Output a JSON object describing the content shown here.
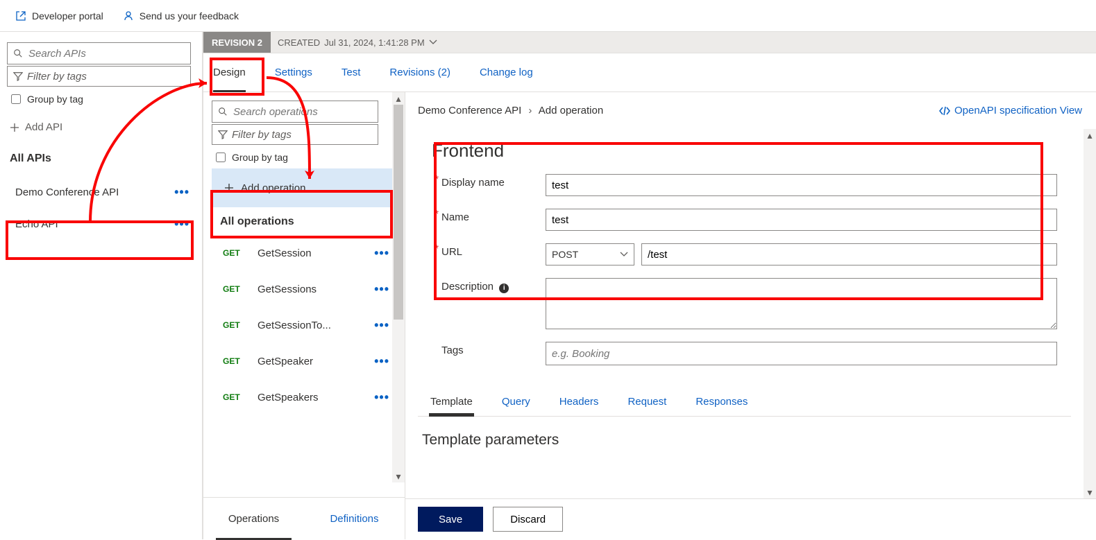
{
  "topbar": {
    "devPortal": "Developer portal",
    "feedback": "Send us your feedback"
  },
  "leftPanel": {
    "searchPlaceholder": "Search APIs",
    "filterPlaceholder": "Filter by tags",
    "groupByTag": "Group by tag",
    "addApi": "Add API",
    "allApisHeader": "All APIs",
    "apis": [
      {
        "name": "Demo Conference API"
      },
      {
        "name": "Echo API"
      }
    ]
  },
  "revisionBar": {
    "badge": "REVISION 2",
    "createdPrefix": "CREATED",
    "createdDate": "Jul 31, 2024, 1:41:28 PM"
  },
  "mainTabs": {
    "design": "Design",
    "settings": "Settings",
    "test": "Test",
    "revisions": "Revisions (2)",
    "changeLog": "Change log"
  },
  "opsPanel": {
    "searchPlaceholder": "Search operations",
    "filterPlaceholder": "Filter by tags",
    "groupByTag": "Group by tag",
    "addOperation": "Add operation",
    "allOpsHeader": "All operations",
    "operations": [
      {
        "method": "GET",
        "name": "GetSession"
      },
      {
        "method": "GET",
        "name": "GetSessions"
      },
      {
        "method": "GET",
        "name": "GetSessionTo..."
      },
      {
        "method": "GET",
        "name": "GetSpeaker"
      },
      {
        "method": "GET",
        "name": "GetSpeakers"
      }
    ],
    "tabOperations": "Operations",
    "tabDefinitions": "Definitions"
  },
  "breadcrumb": {
    "api": "Demo Conference API",
    "op": "Add operation"
  },
  "openApiLink": "OpenAPI specification View",
  "frontend": {
    "title": "Frontend",
    "labels": {
      "displayName": "Display name",
      "name": "Name",
      "url": "URL",
      "description": "Description",
      "tags": "Tags"
    },
    "values": {
      "displayName": "test",
      "name": "test",
      "method": "POST",
      "urlPath": "/test",
      "description": "",
      "tagsPlaceholder": "e.g. Booking"
    }
  },
  "subTabs": {
    "template": "Template",
    "query": "Query",
    "headers": "Headers",
    "request": "Request",
    "responses": "Responses"
  },
  "templateParamsHeader": "Template parameters",
  "buttons": {
    "save": "Save",
    "discard": "Discard"
  }
}
